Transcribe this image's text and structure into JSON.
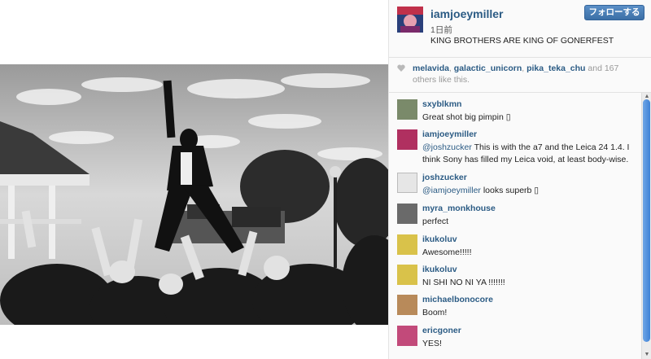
{
  "post": {
    "username": "iamjoeymiller",
    "time": "1日前",
    "caption": "KING BROTHERS ARE KING OF GONERFEST",
    "follow_label": "フォローする"
  },
  "likes": {
    "users": [
      "melavida",
      "galactic_unicorn",
      "pika_teka_chu"
    ],
    "and_text": " and ",
    "count_text": "167",
    "suffix": " others like this."
  },
  "comments": [
    {
      "user": "sxyblkmn",
      "text": "Great shot big pimpin ▯",
      "avatar_color": "#7a8a6a"
    },
    {
      "user": "iamjoeymiller",
      "mention": "@joshzucker",
      "text": " This is with the a7 and the Leica 24 1.4. I think Sony has filled my Leica void, at least body-wise.",
      "avatar_color": "#b03060"
    },
    {
      "user": "joshzucker",
      "mention": "@iamjoeymiller",
      "text": " looks superb ▯",
      "avatar_color": "#e6e6e6"
    },
    {
      "user": "myra_monkhouse",
      "text": "perfect",
      "avatar_color": "#6a6a6a"
    },
    {
      "user": "ikukoluv",
      "text": "Awesome!!!!!",
      "avatar_color": "#d9c24a"
    },
    {
      "user": "ikukoluv",
      "text": "NI SHI NO NI YA !!!!!!!",
      "avatar_color": "#d9c24a"
    },
    {
      "user": "michaelbonocore",
      "text": "Boom!",
      "avatar_color": "#b88a5a"
    },
    {
      "user": "ericgoner",
      "text": "YES!",
      "avatar_color": "#c24a7a"
    }
  ],
  "icons": {
    "heart": "heart-icon",
    "scroll_up": "▲",
    "scroll_down": "▼"
  },
  "colors": {
    "link": "#2b5b84",
    "button": "#3c6fa6",
    "scroll_thumb": "#3f82d6"
  }
}
